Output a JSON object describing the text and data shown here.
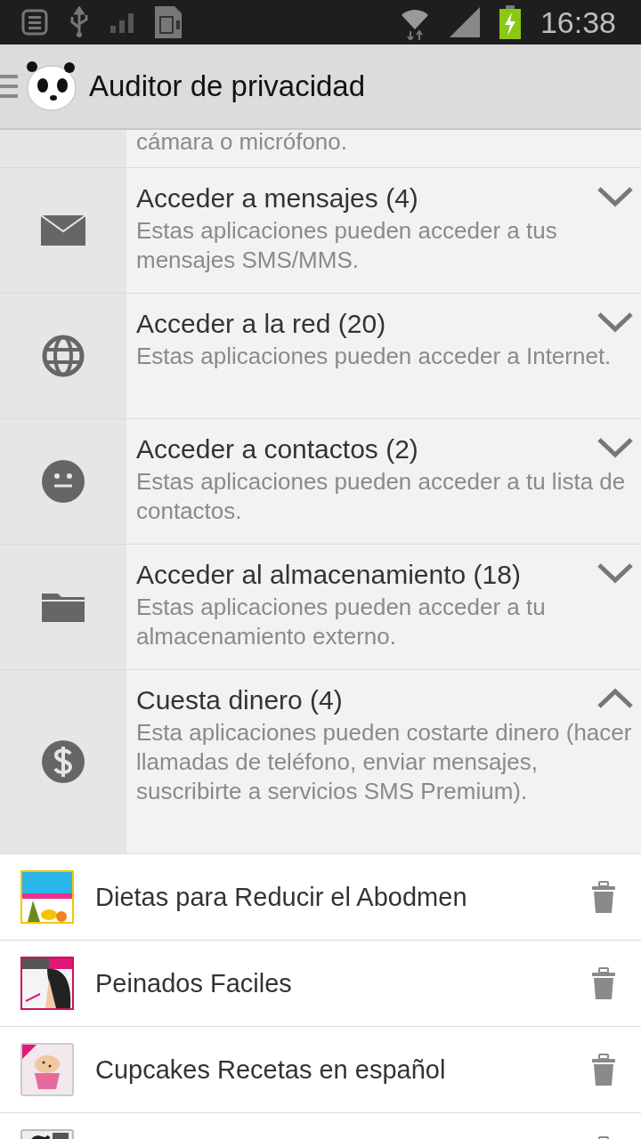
{
  "status_bar": {
    "time": "16:38"
  },
  "action_bar": {
    "title": "Auditor de privacidad"
  },
  "categories": [
    {
      "kind": "partial",
      "description": "cámara o micrófono."
    },
    {
      "kind": "mail",
      "title": "Acceder a mensajes (4)",
      "description": "Estas aplicaciones pueden acceder a tus mensajes SMS/MMS.",
      "expanded": false
    },
    {
      "kind": "globe",
      "title": "Acceder a la red (20)",
      "description": "Estas aplicaciones pueden acceder a Internet.",
      "expanded": false
    },
    {
      "kind": "face",
      "title": "Acceder a contactos (2)",
      "description": "Estas aplicaciones pueden acceder a tu lista de contactos.",
      "expanded": false
    },
    {
      "kind": "folder",
      "title": "Acceder al almacenamiento (18)",
      "description": "Estas aplicaciones pueden acceder a tu almacenamiento externo.",
      "expanded": false
    },
    {
      "kind": "dollar",
      "title": "Cuesta dinero (4)",
      "description": "Esta aplicaciones pueden costarte dinero (hacer llamadas de teléfono, enviar mensajes, suscribirte a servicios SMS Premium).",
      "expanded": true
    }
  ],
  "apps": [
    {
      "name": "Dietas para Reducir el Abodmen"
    },
    {
      "name": "Peinados Faciles"
    },
    {
      "name": "Cupcakes Recetas en español"
    },
    {
      "kind": "partial"
    }
  ]
}
